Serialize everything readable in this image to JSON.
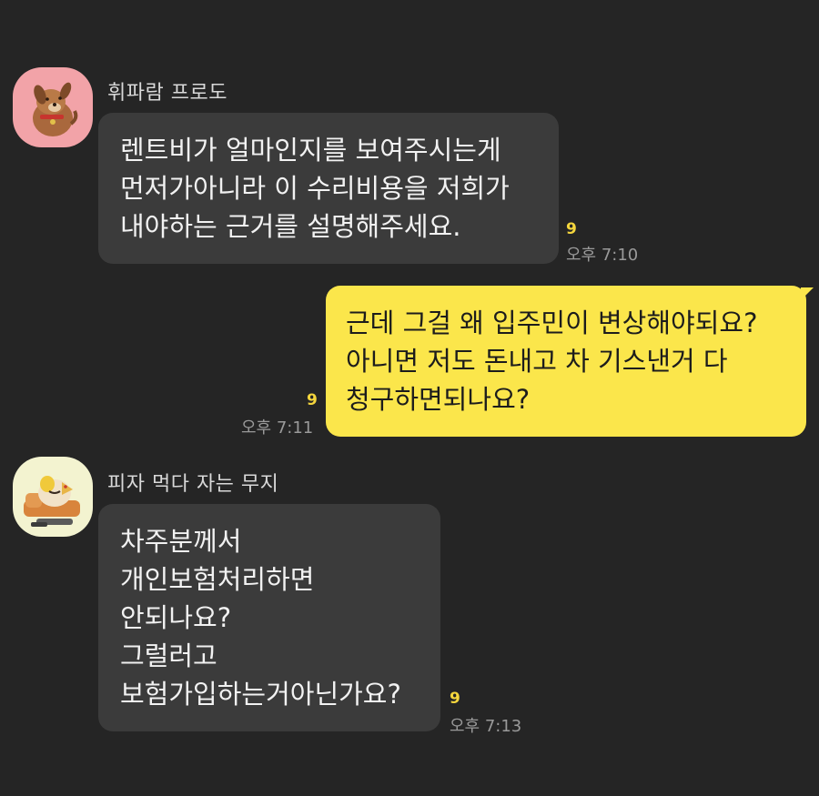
{
  "colors": {
    "background": "#252525",
    "incoming_bubble": "#3b3b3b",
    "outgoing_bubble": "#fbe64b",
    "unread": "#f5d63d"
  },
  "messages": [
    {
      "sender": "휘파람 프로도",
      "avatar_icon": "frodo-dog-icon",
      "lines": [
        "렌트비가 얼마인지를 보여주시는게",
        "먼저가아니라 이 수리비용을 저희가",
        "내야하는 근거를 설명해주세요."
      ],
      "unread": "9",
      "time": "오후 7:10"
    },
    {
      "sender": "",
      "lines": [
        "근데 그걸 왜 입주민이 변상해야되요?",
        "아니면 저도 돈내고 차 기스낸거 다",
        "청구하면되나요?"
      ],
      "unread": "9",
      "time": "오후 7:11"
    },
    {
      "sender": "피자 먹다 자는 무지",
      "avatar_icon": "muzi-sleeping-icon",
      "lines": [
        "차주분께서",
        "개인보험처리하면",
        "안되나요?",
        "그럴러고",
        "보험가입하는거아닌가요?"
      ],
      "unread": "9",
      "time": "오후 7:13"
    }
  ]
}
